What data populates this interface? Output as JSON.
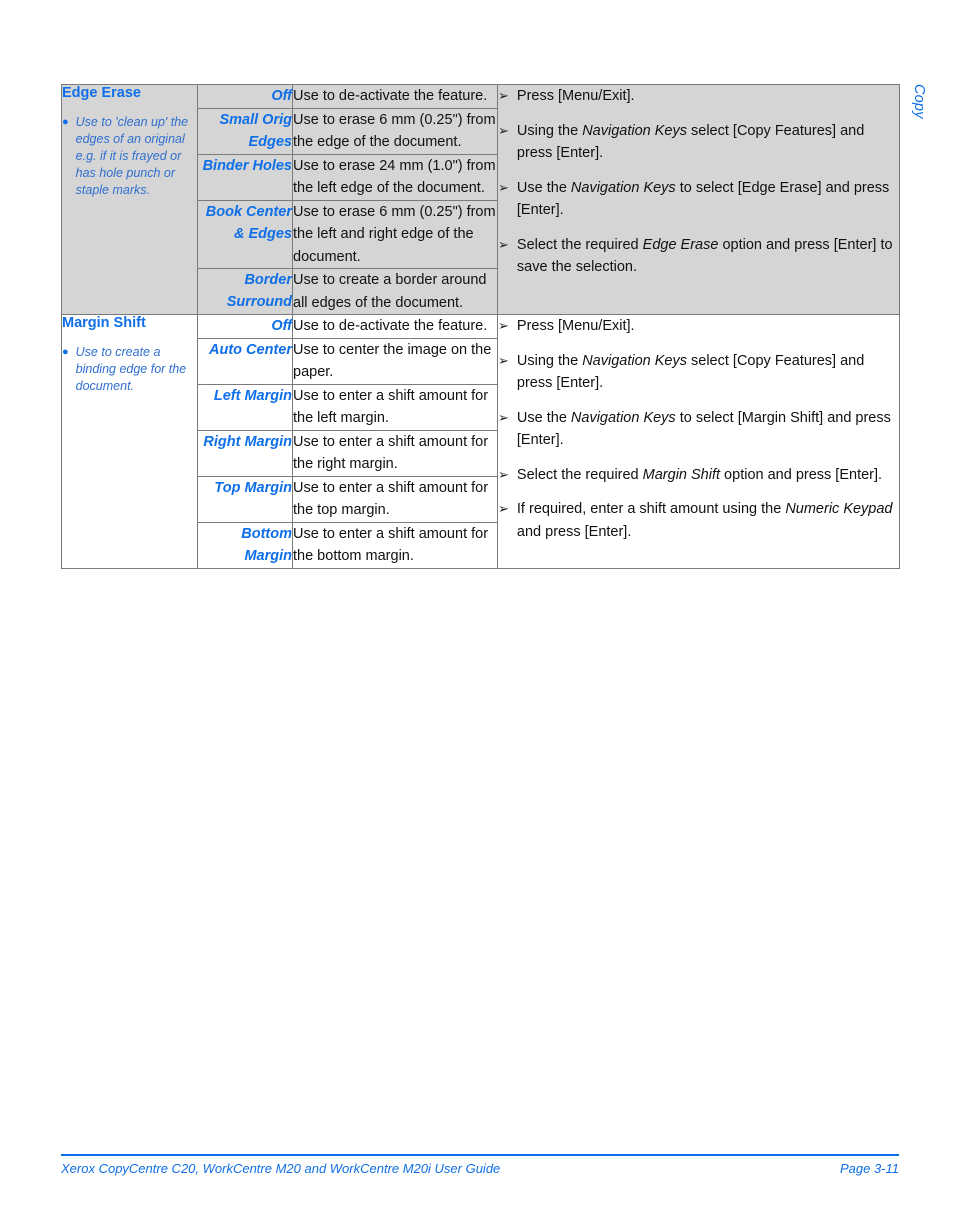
{
  "side_tab": "Copy",
  "table": {
    "sections": [
      {
        "shaded": true,
        "feature": {
          "title": "Edge Erase",
          "bullets": [
            "Use to 'clean up' the edges of an original e.g. if it is frayed or has hole punch or staple marks."
          ]
        },
        "rows": [
          {
            "option": "Off",
            "description": "Use to de-activate the feature."
          },
          {
            "option": "Small Orig Edges",
            "description": "Use to erase 6 mm (0.25\") from the edge of the document."
          },
          {
            "option": "Binder Holes",
            "description": "Use to erase 24 mm (1.0\") from the left edge of the document."
          },
          {
            "option": "Book Center & Edges",
            "description": "Use to erase 6 mm (0.25\") from the left and right edge of the document."
          },
          {
            "option": "Border Surround",
            "description": "Use to create a border around all edges of the document."
          }
        ],
        "steps": [
          [
            {
              "t": "Press [Menu/Exit].",
              "i": false
            }
          ],
          [
            {
              "t": "Using the ",
              "i": false
            },
            {
              "t": "Navigation Keys",
              "i": true
            },
            {
              "t": " select [Copy Features] and press [Enter].",
              "i": false
            }
          ],
          [
            {
              "t": "Use the ",
              "i": false
            },
            {
              "t": "Navigation Keys",
              "i": true
            },
            {
              "t": " to select [Edge Erase] and press [Enter].",
              "i": false
            }
          ],
          [
            {
              "t": "Select the required ",
              "i": false
            },
            {
              "t": "Edge Erase",
              "i": true
            },
            {
              "t": " option and press [Enter] to save the selection.",
              "i": false
            }
          ]
        ]
      },
      {
        "shaded": false,
        "feature": {
          "title": "Margin Shift",
          "bullets": [
            "Use to create a binding edge for the document."
          ]
        },
        "rows": [
          {
            "option": "Off",
            "description": "Use to de-activate the feature."
          },
          {
            "option": "Auto Center",
            "description": "Use to center the image on the paper."
          },
          {
            "option": "Left Margin",
            "description": "Use to enter a shift amount for the left margin."
          },
          {
            "option": "Right Margin",
            "description": "Use to enter a shift amount for the right margin."
          },
          {
            "option": "Top Margin",
            "description": "Use to enter a shift amount for the top margin."
          },
          {
            "option": "Bottom Margin",
            "description": "Use to enter a shift amount for the bottom margin."
          }
        ],
        "steps": [
          [
            {
              "t": "Press [Menu/Exit].",
              "i": false
            }
          ],
          [
            {
              "t": "Using the ",
              "i": false
            },
            {
              "t": "Navigation Keys",
              "i": true
            },
            {
              "t": " select [Copy Features] and press [Enter].",
              "i": false
            }
          ],
          [
            {
              "t": "Use the ",
              "i": false
            },
            {
              "t": "Navigation Keys",
              "i": true
            },
            {
              "t": " to select [Margin Shift] and press [Enter].",
              "i": false
            }
          ],
          [
            {
              "t": "Select the required ",
              "i": false
            },
            {
              "t": "Margin Shift",
              "i": true
            },
            {
              "t": " option and press [Enter].",
              "i": false
            }
          ],
          [
            {
              "t": "If required, enter a shift amount using the ",
              "i": false
            },
            {
              "t": "Numeric Keypad",
              "i": true
            },
            {
              "t": " and press [Enter].",
              "i": false
            }
          ]
        ]
      }
    ]
  },
  "footer": {
    "left": "Xerox CopyCentre C20, WorkCentre M20 and WorkCentre M20i User Guide",
    "right": "Page 3-11"
  },
  "glyphs": {
    "bullet": "●",
    "step_arrow": "➢"
  },
  "colors": {
    "accent_blue": "#0f6fe8",
    "body_text": "#111111",
    "shaded_bg": "#d5d5d5",
    "border": "#7a7a7a"
  }
}
